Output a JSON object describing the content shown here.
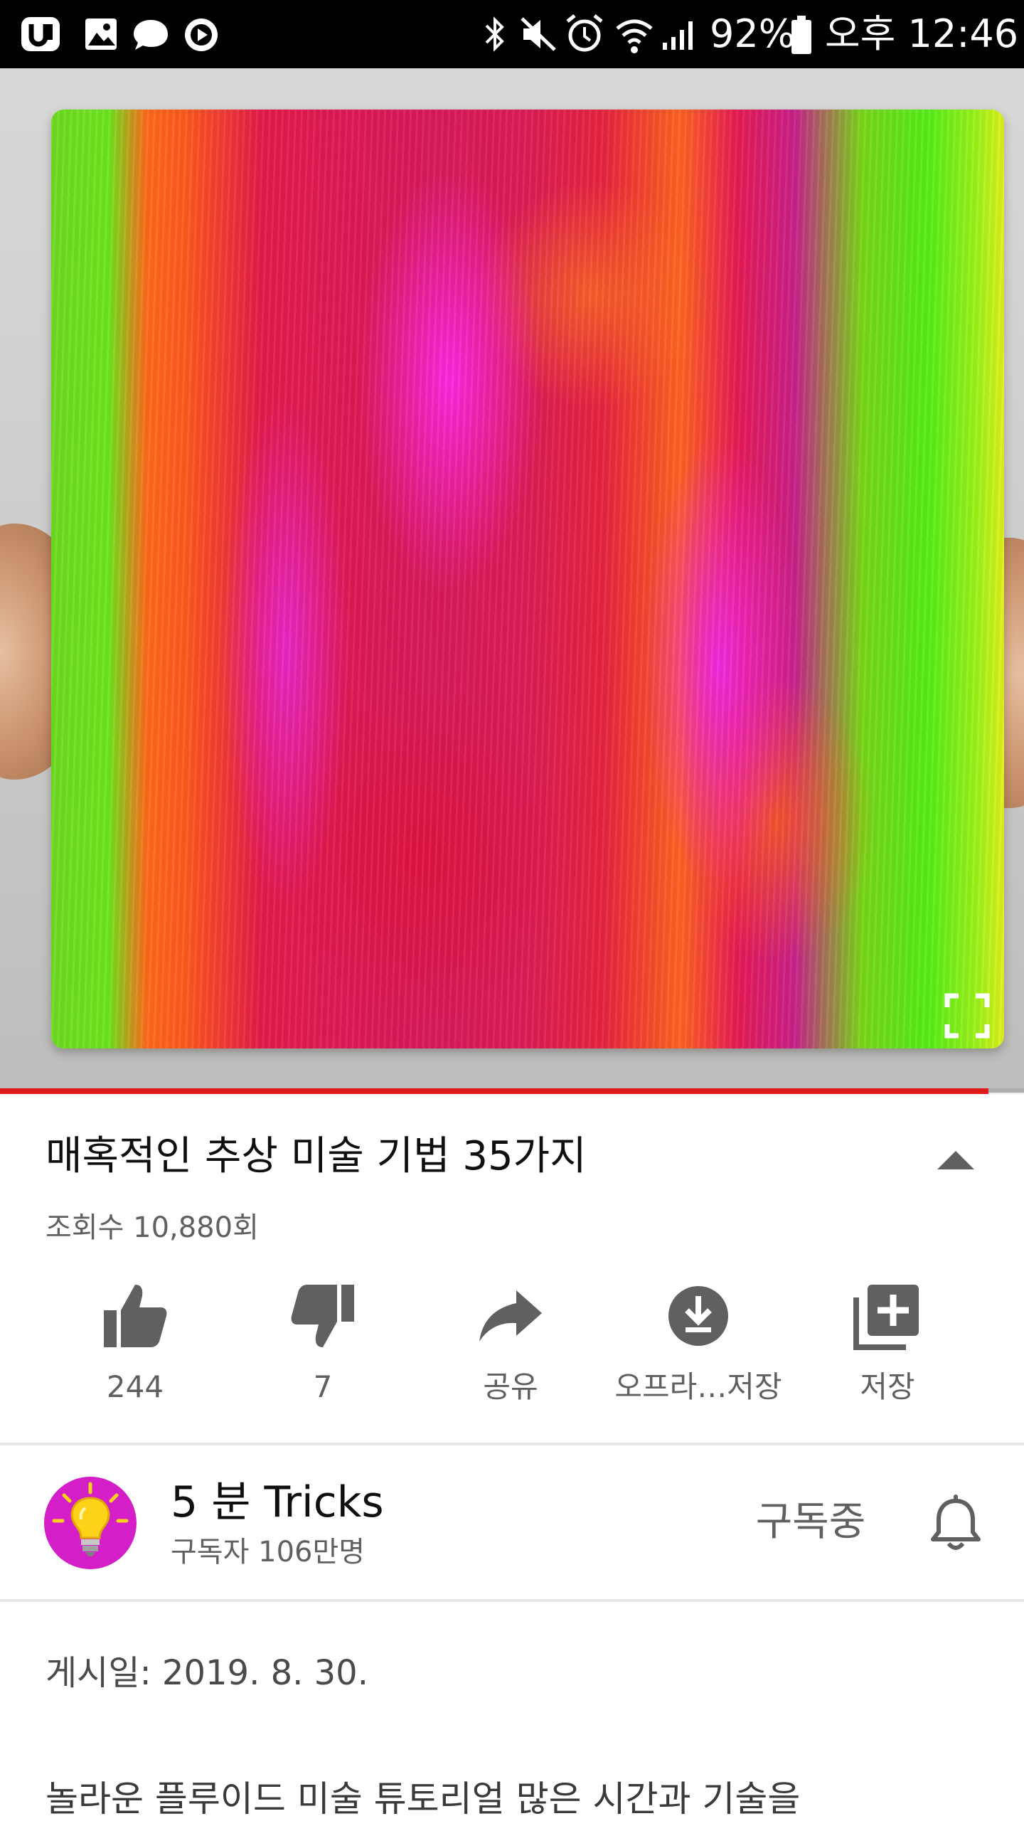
{
  "status_bar": {
    "battery": "92%",
    "time": "오후 12:46",
    "left_icons": [
      "app-u-icon",
      "gallery-icon",
      "chat-bubble-icon",
      "play-circle-icon"
    ],
    "right_icons": [
      "bluetooth-icon",
      "mute-icon",
      "alarm-icon",
      "wifi-icon",
      "signal-icon",
      "battery-icon"
    ]
  },
  "video": {
    "progress": 0.965,
    "accent_color": "#e01b1b"
  },
  "title": "매혹적인 추상 미술 기법 35가지",
  "views": "조회수 10,880회",
  "actions": {
    "like": "244",
    "dislike": "7",
    "share": "공유",
    "offline": "오프라…저장",
    "save": "저장"
  },
  "channel": {
    "name": "5 분 Tricks",
    "subscribers": "구독자 106만명",
    "subscribe_state": "구독중"
  },
  "description": {
    "published": "게시일: 2019. 8. 30.",
    "text": "놀라운 플루이드 미술 튜토리얼 많은 시간과 기술을"
  }
}
